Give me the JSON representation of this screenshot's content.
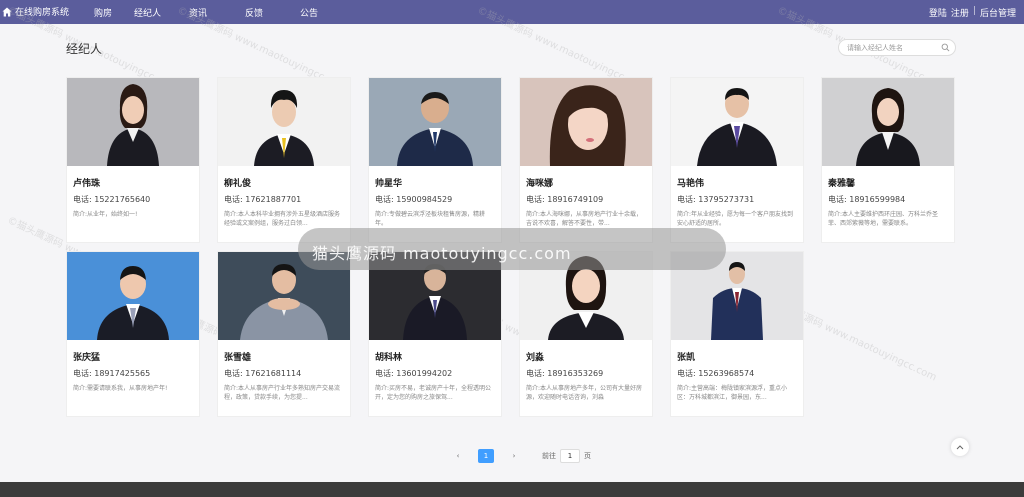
{
  "nav": {
    "brand": "在线购房系统",
    "items": [
      "购房",
      "经纪人",
      "资讯",
      "反馈",
      "公告"
    ],
    "login": "登陆",
    "register": "注册",
    "admin": "后台管理"
  },
  "page_title": "经纪人",
  "search": {
    "placeholder": "请输入经纪人姓名"
  },
  "phone_label": "电话:",
  "agents": [
    {
      "name": "卢伟珠",
      "phone": "15221765640",
      "intro": "简介:从业年，始终如一!"
    },
    {
      "name": "柳礼俊",
      "phone": "17621887701",
      "intro": "简介:本人本科毕业拥有涉外五星级酒店服务经验或文案例组，服务过白领..."
    },
    {
      "name": "帅星华",
      "phone": "15900984529",
      "intro": "简介:专做碧云滨浮泾板块租售房源，精耕年。"
    },
    {
      "name": "海咪娜",
      "phone": "18916749109",
      "intro": "简介:本人海咪娜，从事房地产行业十余载，吉说不欢喜，解答不要性，带..."
    },
    {
      "name": "马艳伟",
      "phone": "13795273731",
      "intro": "简介:年从业经验，愿为每一个客户朋友找到安心舒适的居所。"
    },
    {
      "name": "秦雅馨",
      "phone": "18916599984",
      "intro": "简介:本人主要维护西环庄园、万科兰乔圣菲、西郊紫薇等地，需要联系。"
    },
    {
      "name": "张庆猛",
      "phone": "18917425565",
      "intro": "简介:需要请联系我，从事房地产年!"
    },
    {
      "name": "张雪雄",
      "phone": "17621681114",
      "intro": "简介:本人从事房产行业年多熟知房产交易流程，政策，贷款手续，为您提..."
    },
    {
      "name": "胡科林",
      "phone": "13601994202",
      "intro": "简介:买房不易，老诚房产十年，全程透明公开，定为您的购房之旅保驾..."
    },
    {
      "name": "刘淼",
      "phone": "18916353269",
      "intro": "简介:本人从事房地产多年，公司有大量好房源，欢迎随时电话咨询，刘淼"
    },
    {
      "name": "张凯",
      "phone": "15263968574",
      "intro": "简介:主营高端：梅陇镇家滨源浮，重点小区：万科城都滨江，御景园，东..."
    }
  ],
  "pagination": {
    "current": "1",
    "goto_label": "前往",
    "goto_value": "1",
    "page_unit": "页"
  },
  "watermark": {
    "center": "猫头鹰源码 maotouyingcc.com",
    "tile": "©猫头鹰源码 www.maotouyingcc.com"
  },
  "colors": {
    "navbar": "#5b5d9c",
    "accent": "#409eff"
  }
}
